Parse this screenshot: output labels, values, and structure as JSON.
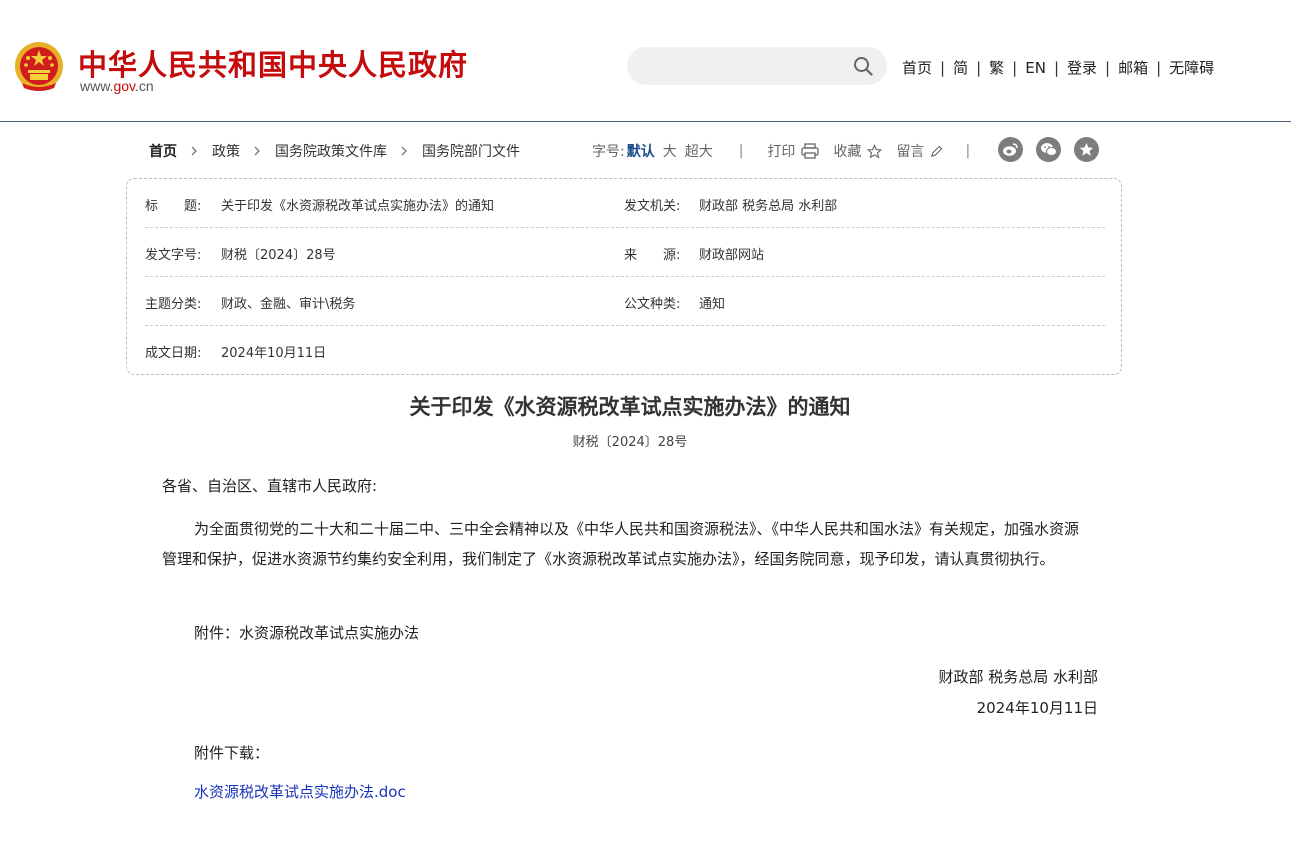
{
  "header": {
    "site_title": "中华人民共和国中央人民政府",
    "site_url_prefix": "www.",
    "site_url_red": "gov",
    "site_url_suffix": ".cn",
    "search": {
      "value": "",
      "placeholder": ""
    },
    "nav": [
      "首页",
      "简",
      "繁",
      "EN",
      "登录",
      "邮箱",
      "无障碍"
    ],
    "nav_separator": "|"
  },
  "breadcrumb": [
    "首页",
    "政策",
    "国务院政策文件库",
    "国务院部门文件"
  ],
  "tools": {
    "font_label": "字号:",
    "font_default": "默认",
    "font_large": "大",
    "font_xlarge": "超大",
    "divider": "|",
    "print": "打印",
    "favorite": "收藏",
    "comment": "留言"
  },
  "social_icons": [
    "weibo-icon",
    "wechat-icon",
    "star-icon"
  ],
  "meta": {
    "title_label": "标　　题:",
    "title_value": "关于印发《水资源税改革试点实施办法》的通知",
    "issuer_label": "发文机关:",
    "issuer_value": "财政部 税务总局 水利部",
    "docno_label": "发文字号:",
    "docno_value": "财税〔2024〕28号",
    "source_label": "来　　源:",
    "source_value": "财政部网站",
    "topic_label": "主题分类:",
    "topic_value": "财政、金融、审计\\税务",
    "type_label": "公文种类:",
    "type_value": "通知",
    "date_label": "成文日期:",
    "date_value": "2024年10月11日"
  },
  "article": {
    "title": "关于印发《水资源税改革试点实施办法》的通知",
    "doc_no": "财税〔2024〕28号",
    "salutation": "各省、自治区、直辖市人民政府:",
    "body": "为全面贯彻党的二十大和二十届二中、三中全会精神以及《中华人民共和国资源税法》、《中华人民共和国水法》有关规定，加强水资源管理和保护，促进水资源节约集约安全利用，我们制定了《水资源税改革试点实施办法》，经国务院同意，现予印发，请认真贯彻执行。",
    "attachment_note": "附件：水资源税改革试点实施办法",
    "signer": "财政部 税务总局 水利部",
    "sign_date": "2024年10月11日",
    "download_label": "附件下载：",
    "download_link": "水资源税改革试点实施办法.doc"
  },
  "colors": {
    "brand_red": "#c40c0c",
    "link_blue": "#1a34b8",
    "accent_blue": "#1a4c8b"
  }
}
